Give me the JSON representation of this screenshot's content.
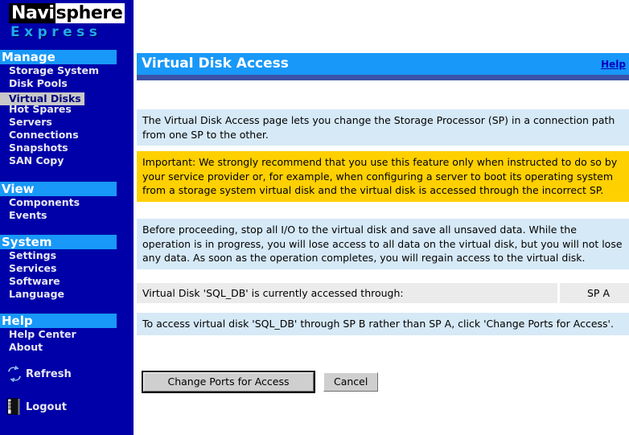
{
  "logo": {
    "part1": "Navi",
    "part2": "sphere",
    "part3": "Express"
  },
  "sidebar": {
    "groups": [
      {
        "header": "Manage",
        "items": [
          {
            "label": "Storage System",
            "selected": false
          },
          {
            "label": "Disk Pools",
            "selected": false
          },
          {
            "label": "Virtual Disks",
            "selected": true
          },
          {
            "label": "Hot Spares",
            "selected": false
          },
          {
            "label": "Servers",
            "selected": false
          },
          {
            "label": "Connections",
            "selected": false
          },
          {
            "label": "Snapshots",
            "selected": false
          },
          {
            "label": "SAN Copy",
            "selected": false
          }
        ]
      },
      {
        "header": "View",
        "items": [
          {
            "label": "Components",
            "selected": false
          },
          {
            "label": "Events",
            "selected": false
          }
        ]
      },
      {
        "header": "System",
        "items": [
          {
            "label": "Settings",
            "selected": false
          },
          {
            "label": "Services",
            "selected": false
          },
          {
            "label": "Software",
            "selected": false
          },
          {
            "label": "Language",
            "selected": false
          }
        ]
      },
      {
        "header": "Help",
        "items": [
          {
            "label": "Help Center",
            "selected": false
          },
          {
            "label": "About",
            "selected": false
          }
        ]
      }
    ],
    "actions": [
      {
        "label": "Refresh",
        "icon": "refresh-icon"
      },
      {
        "label": "Logout",
        "icon": "logout-icon"
      }
    ]
  },
  "header": {
    "title": "Virtual Disk Access",
    "help_label": "Help"
  },
  "main": {
    "intro": "The Virtual Disk Access page lets you change the Storage Processor (SP) in a connection path from one SP to the other.",
    "important": "Important: We strongly recommend that you use this feature only when instructed to do so by your service provider or, for example, when configuring a server to boot its operating system from a storage system virtual disk and the virtual disk is accessed through the incorrect SP.",
    "before": "Before proceeding, stop all I/O to the virtual disk and save all unsaved data. While the operation is in progress, you will lose access to all data on the virtual disk, but you will not lose any data. As soon as the operation completes, you will regain access to the virtual disk.",
    "status_label": "Virtual Disk 'SQL_DB' is currently accessed through:",
    "status_value": "SP A",
    "instruction": "To access virtual disk 'SQL_DB' through SP B rather than SP A, click 'Change Ports for Access'."
  },
  "buttons": {
    "primary": "Change Ports for Access",
    "cancel": "Cancel"
  },
  "colors": {
    "sidebar_bg": "#0000a8",
    "accent_blue": "#1898f8",
    "warn_yellow": "#ffd000",
    "info_blue": "#d6e9f7",
    "gray_row": "#ebebeb",
    "logo_cyan": "#21a7f0"
  }
}
